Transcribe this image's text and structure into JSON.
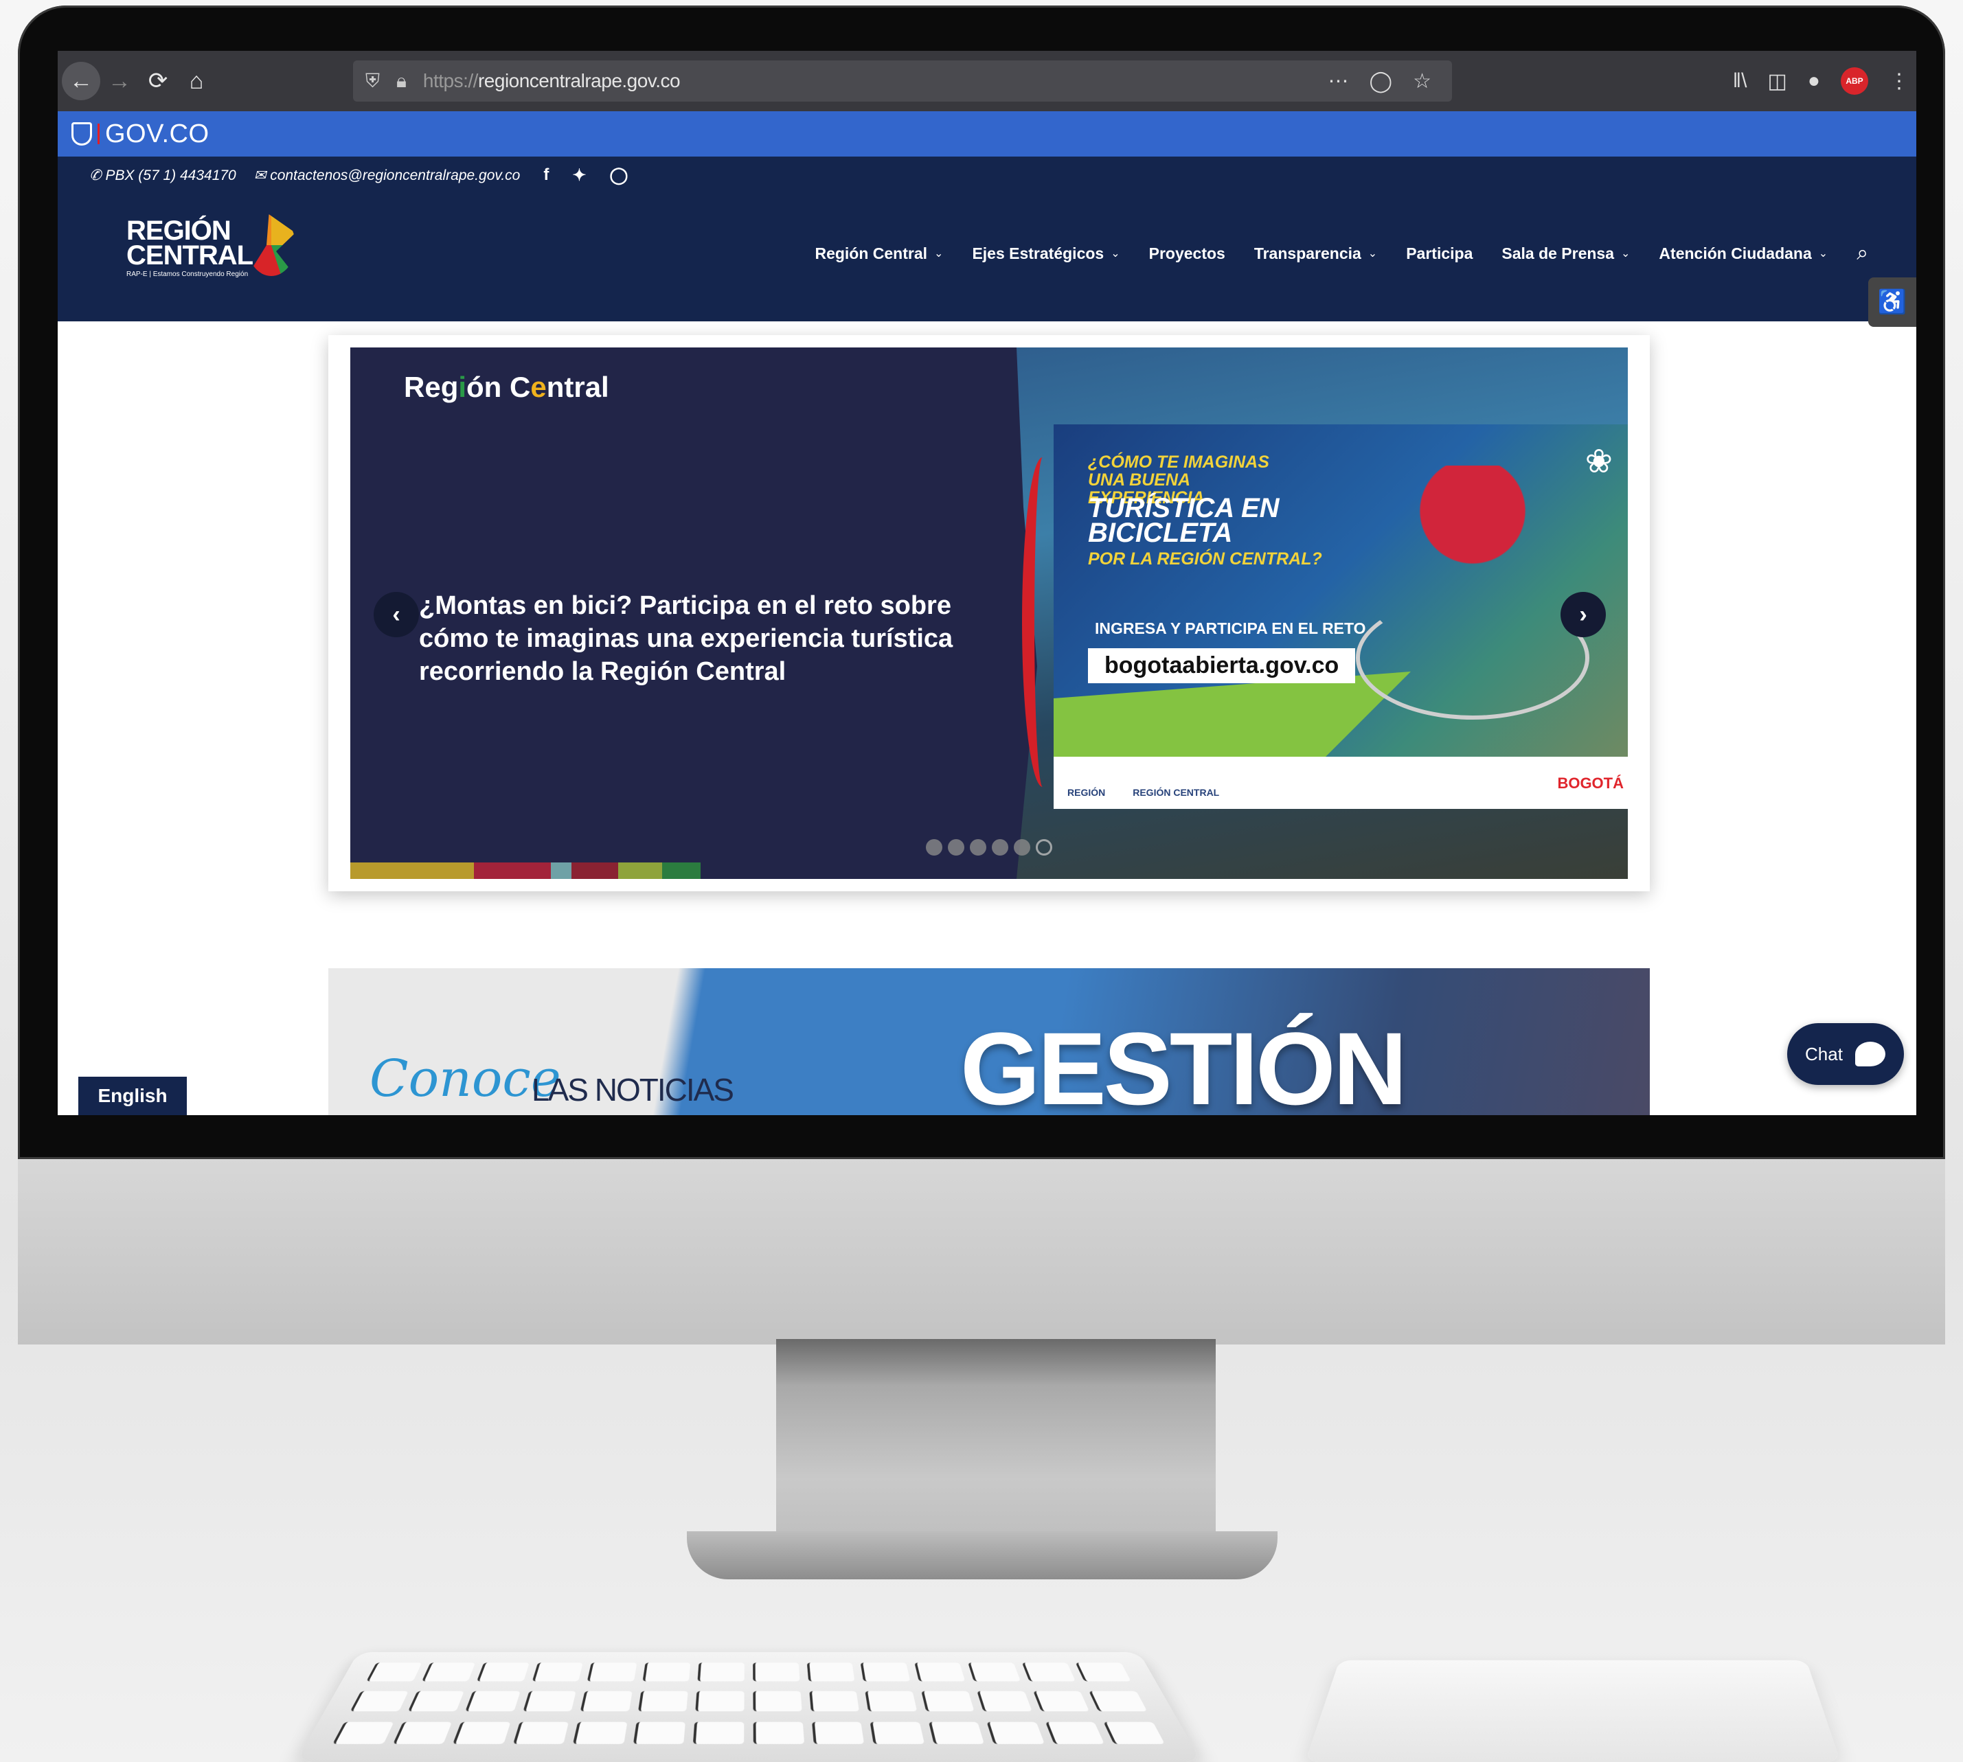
{
  "browser": {
    "url_protocol": "https://",
    "url_host": "regioncentralrape.gov.co",
    "adblock_label": "ABP"
  },
  "govco": {
    "label": "GOV.CO"
  },
  "topbar": {
    "phone": "PBX (57 1) 4434170",
    "email": "contactenos@regioncentralrape.gov.co",
    "social": [
      "f",
      "t",
      "ig"
    ]
  },
  "logo": {
    "line1": "REGIÓN",
    "line2": "CENTRAL",
    "tagline": "RAP-E | Estamos Construyendo Región"
  },
  "nav": {
    "items": [
      {
        "label": "Región Central",
        "dropdown": true
      },
      {
        "label": "Ejes Estratégicos",
        "dropdown": true
      },
      {
        "label": "Proyectos",
        "dropdown": false
      },
      {
        "label": "Transparencia",
        "dropdown": true
      },
      {
        "label": "Participa",
        "dropdown": false
      },
      {
        "label": "Sala de Prensa",
        "dropdown": true
      },
      {
        "label": "Atención Ciudadana",
        "dropdown": true
      }
    ],
    "search_icon": "search-icon"
  },
  "slider": {
    "brand_1": "Reg",
    "brand_i": "i",
    "brand_2": "ón C",
    "brand_e": "e",
    "brand_3": "ntral",
    "headline": "¿Montas en bici? Participa en el reto sobre cómo te imaginas una experiencia turística recorriendo la Región Central",
    "poster_q1": "¿CÓMO TE IMAGINAS UNA BUENA EXPERIENCIA",
    "poster_q2": "TURÍSTICA EN BICICLETA",
    "poster_q3": "POR LA REGIÓN CENTRAL?",
    "poster_cta": "INGRESA Y PARTICIPA EN EL RETO",
    "poster_site": "bogotaabierta.gov.co",
    "poster_logo_1": "REGIÓN",
    "poster_logo_2": "REGIÓN CENTRAL",
    "poster_bogota": "BOGOTÁ",
    "total_slides": 6,
    "active_slide": 6,
    "colorbar": [
      "#b89a2c",
      "#a3233a",
      "#6fa1a6",
      "#8a2232",
      "#8ea33b",
      "#2b7c3f"
    ]
  },
  "gestion": {
    "conoce": "Conoce",
    "noticias": "LAS NOTICIAS",
    "title": "GESTIÓN"
  },
  "language_button": "English",
  "chat_button": "Chat"
}
